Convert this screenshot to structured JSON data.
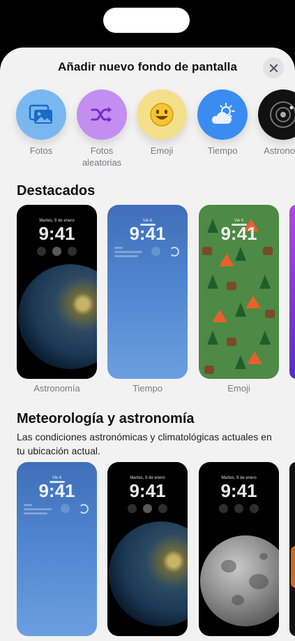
{
  "sheet": {
    "title": "Añadir nuevo fondo de pantalla",
    "close_icon": "close-icon"
  },
  "categories": [
    {
      "label": "Fotos",
      "icon": "photos-icon",
      "color": "#7ab7f0"
    },
    {
      "label": "Fotos aleatorias",
      "icon": "shuffle-icon",
      "color": "#c28ff0"
    },
    {
      "label": "Emoji",
      "icon": "smiley-icon",
      "color": "#f4e08a"
    },
    {
      "label": "Tiempo",
      "icon": "weather-icon",
      "color": "#3a8cf0"
    },
    {
      "label": "Astronom",
      "icon": "astronomy-icon",
      "color": "#111111"
    }
  ],
  "featured": {
    "title": "Destacados",
    "cards": [
      {
        "label": "Astronomía",
        "date": "Martes, 9 de enero",
        "time": "9:41"
      },
      {
        "label": "Tiempo",
        "date": "Vie 6",
        "time": "9:41"
      },
      {
        "label": "Emoji",
        "date": "Vie 6",
        "time": "9:41"
      }
    ]
  },
  "weather_astro": {
    "title": "Meteorología y astronomía",
    "description": "Las condiciones astronómicas y climatológicas actuales en tu ubicación actual.",
    "cards": [
      {
        "date": "Vie 6",
        "time": "9:41"
      },
      {
        "date": "Martes, 9 de enero",
        "time": "9:41"
      },
      {
        "date": "Martes, 9 de enero",
        "time": "9:41"
      }
    ]
  }
}
